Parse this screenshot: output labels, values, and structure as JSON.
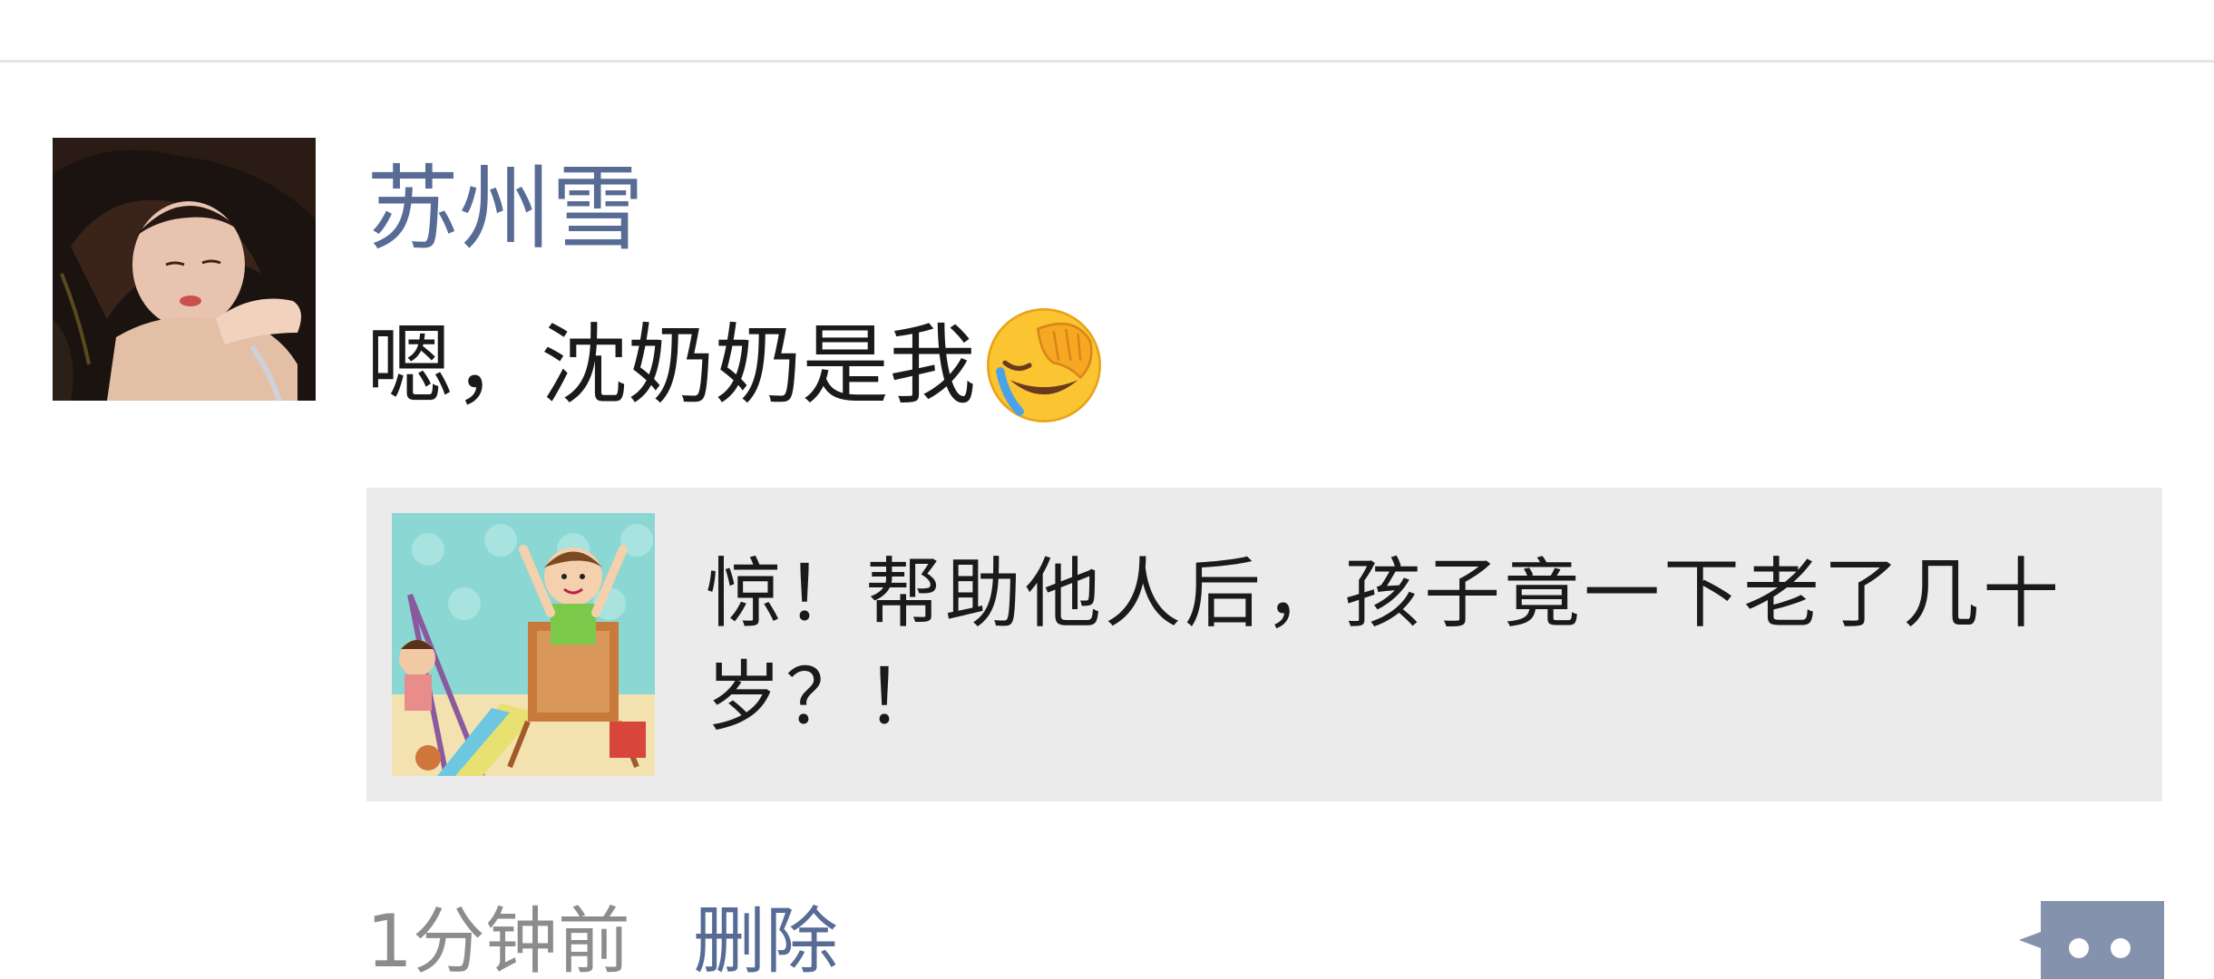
{
  "post": {
    "username": "苏州雪",
    "text": "嗯，沈奶奶是我",
    "emoji_icon": "face-palm-laughing-emoji",
    "share": {
      "title": "惊！帮助他人后，孩子竟一下老了几十岁？！",
      "thumbnail_icon": "kids-playground-illustration"
    },
    "time": "1分钟前",
    "delete_label": "删除",
    "more_icon": "comment-more-icon"
  },
  "colors": {
    "username": "#576b95",
    "link": "#576b95",
    "meta": "#8c8c8c",
    "card_bg": "#ebebeb",
    "divider": "#e4e4e4"
  }
}
